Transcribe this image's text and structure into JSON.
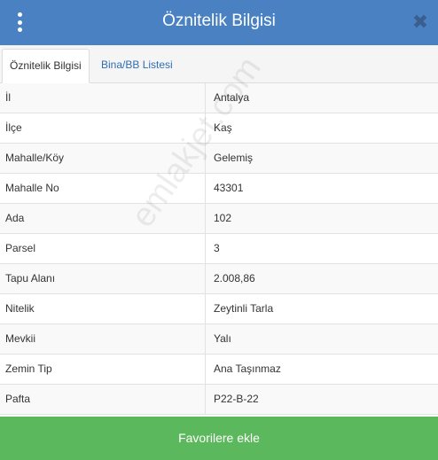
{
  "header": {
    "title": "Öznitelik Bilgisi",
    "menu_icon": "vertical-dots-icon",
    "close_icon": "close-icon",
    "close_glyph": "✖",
    "color": "#4a81c2"
  },
  "tabs": [
    {
      "label": "Öznitelik Bilgisi",
      "active": true
    },
    {
      "label": "Bina/BB Listesi",
      "active": false
    }
  ],
  "rows": [
    {
      "label": "İl",
      "value": "Antalya"
    },
    {
      "label": "İlçe",
      "value": "Kaş"
    },
    {
      "label": "Mahalle/Köy",
      "value": "Gelemiş"
    },
    {
      "label": "Mahalle No",
      "value": "43301"
    },
    {
      "label": "Ada",
      "value": "102"
    },
    {
      "label": "Parsel",
      "value": "3"
    },
    {
      "label": "Tapu Alanı",
      "value": "2.008,86"
    },
    {
      "label": "Nitelik",
      "value": "Zeytinli Tarla"
    },
    {
      "label": "Mevkii",
      "value": "Yalı"
    },
    {
      "label": "Zemin Tip",
      "value": "Ana Taşınmaz"
    },
    {
      "label": "Pafta",
      "value": "P22-B-22"
    }
  ],
  "watermark": "emlakjet.com",
  "footer": {
    "button_label": "Favorilere ekle",
    "color": "#5cb85c"
  }
}
